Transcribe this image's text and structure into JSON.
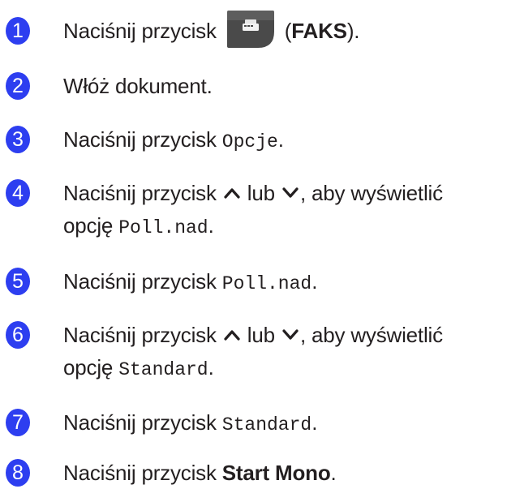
{
  "steps": [
    {
      "number": "1",
      "before": "Naciśnij przycisk ",
      "middle": " (",
      "bold": "FAKS",
      "after": ")."
    },
    {
      "number": "2",
      "text": "Włóż dokument."
    },
    {
      "number": "3",
      "before": "Naciśnij przycisk ",
      "mono": "Opcje",
      "after": "."
    },
    {
      "number": "4",
      "before": "Naciśnij przycisk ",
      "or": " lub ",
      "after_line1": ", aby wyświetlić",
      "line2_before": "opcję ",
      "mono": "Poll.nad",
      "after": "."
    },
    {
      "number": "5",
      "before": "Naciśnij przycisk ",
      "mono": "Poll.nad",
      "after": "."
    },
    {
      "number": "6",
      "before": "Naciśnij przycisk ",
      "or": " lub ",
      "after_line1": ", aby wyświetlić",
      "line2_before": "opcję ",
      "mono": "Standard",
      "after": "."
    },
    {
      "number": "7",
      "before": "Naciśnij przycisk ",
      "mono": "Standard",
      "after": "."
    },
    {
      "number": "8",
      "before": "Naciśnij przycisk ",
      "bold": "Start Mono",
      "after": "."
    }
  ],
  "icons": {
    "fax_button": "fax-button-icon",
    "up": "chevron-up-icon",
    "down": "chevron-down-icon"
  },
  "colors": {
    "step_badge": "#2d3ef0",
    "fax_button": "#4a4a4a",
    "text": "#231f20"
  }
}
